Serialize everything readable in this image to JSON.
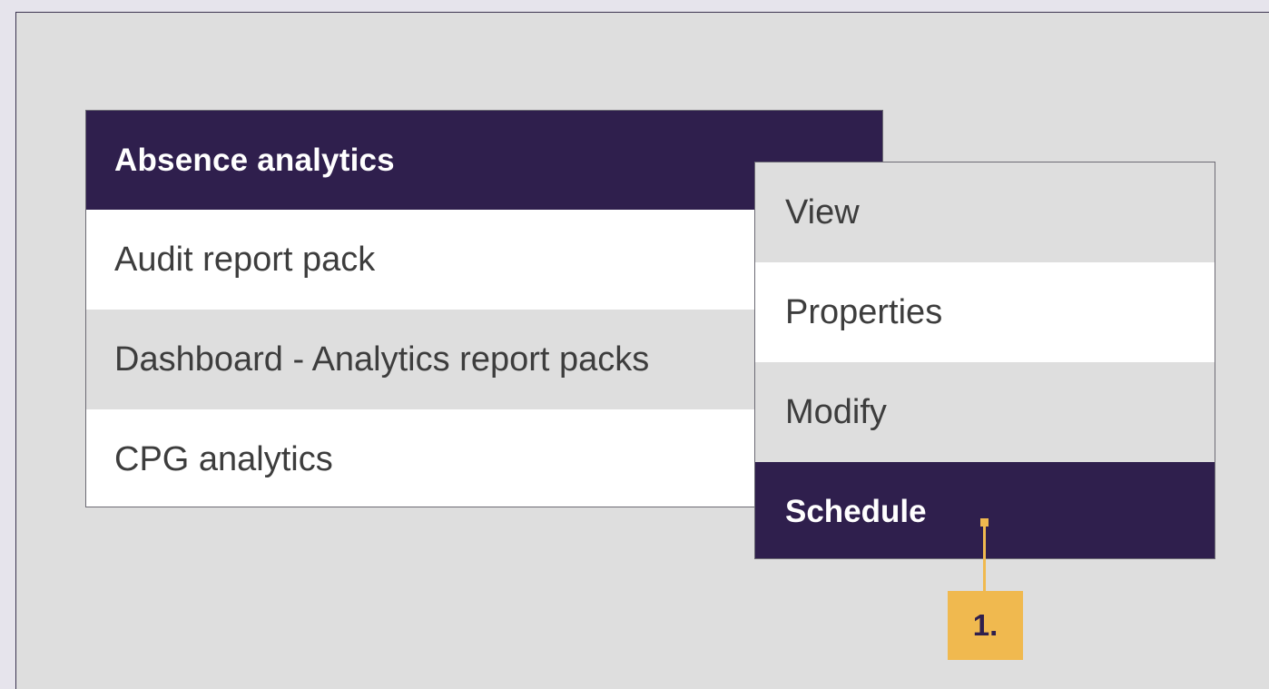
{
  "report_list": {
    "header": "Absence analytics",
    "items": [
      {
        "label": "Audit report pack"
      },
      {
        "label": "Dashboard - Analytics report packs"
      },
      {
        "label": "CPG analytics"
      }
    ]
  },
  "context_menu": {
    "items": [
      {
        "label": "View"
      },
      {
        "label": "Properties"
      },
      {
        "label": "Modify"
      },
      {
        "label": "Schedule"
      }
    ]
  },
  "callout": {
    "label": "1."
  },
  "colors": {
    "accent": "#2f1f4d",
    "callout": "#f0b94f",
    "background": "#dedede"
  }
}
